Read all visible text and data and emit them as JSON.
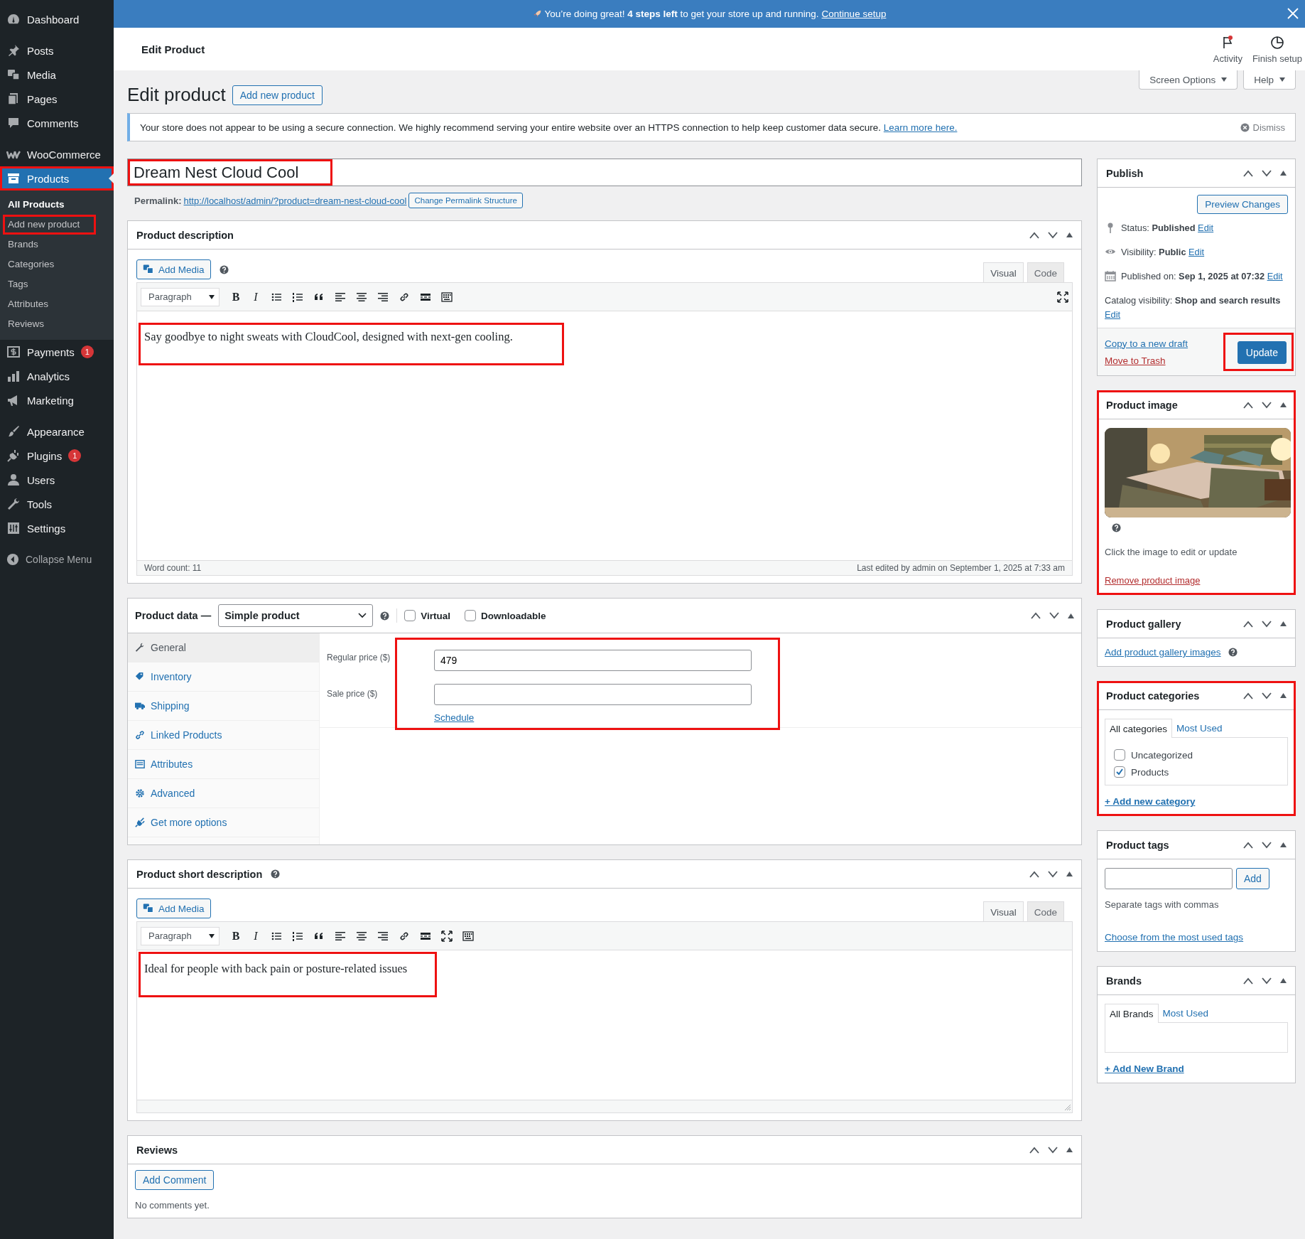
{
  "notice_bar": {
    "text": "You’re doing great! **4 steps left** to get your store up and running.",
    "link": "Continue setup"
  },
  "sidebar": {
    "groups": [
      [
        {
          "label": "Dashboard",
          "selected": false,
          "highlighted": false
        }
      ],
      [
        {
          "label": "Posts",
          "selected": false,
          "highlighted": false
        },
        {
          "label": "Media",
          "selected": false,
          "highlighted": false
        },
        {
          "label": "Pages",
          "selected": false,
          "highlighted": false
        },
        {
          "label": "Comments",
          "selected": false,
          "highlighted": false
        }
      ],
      [
        {
          "label": "WooCommerce",
          "selected": false,
          "highlighted": false
        },
        {
          "label": "Products",
          "selected": true,
          "highlighted": true,
          "children": [
            {
              "label": "All Products",
              "selected": true,
              "highlighted": false
            },
            {
              "label": "Add new product",
              "selected": false,
              "highlighted": true
            },
            {
              "label": "Brands",
              "selected": false,
              "highlighted": false
            },
            {
              "label": "Categories",
              "selected": false,
              "highlighted": false
            },
            {
              "label": "Tags",
              "selected": false,
              "highlighted": false
            },
            {
              "label": "Attributes",
              "selected": false,
              "highlighted": false
            },
            {
              "label": "Reviews",
              "selected": false,
              "highlighted": false
            }
          ]
        },
        {
          "label": "Payments",
          "badge": "1",
          "selected": false,
          "highlighted": false
        },
        {
          "label": "Analytics",
          "selected": false,
          "highlighted": false
        },
        {
          "label": "Marketing",
          "selected": false,
          "highlighted": false
        }
      ],
      [
        {
          "label": "Appearance",
          "selected": false,
          "highlighted": false
        },
        {
          "label": "Plugins",
          "badge": "1",
          "selected": false,
          "highlighted": false
        },
        {
          "label": "Users",
          "selected": false,
          "highlighted": false
        },
        {
          "label": "Tools",
          "selected": false,
          "highlighted": false
        },
        {
          "label": "Settings",
          "selected": false,
          "highlighted": false
        }
      ]
    ],
    "collapse": "Collapse Menu"
  },
  "header": {
    "title": "Edit Product",
    "actions": [
      {
        "label": "Activity",
        "unread": true
      },
      {
        "label": "Finish setup",
        "unread": false
      }
    ]
  },
  "screen_tabs": [
    "Screen Options",
    "Help"
  ],
  "page": {
    "heading": "Edit product",
    "add_button": "Add new product"
  },
  "notice": {
    "text": "Your store does not appear to be using a secure connection. We highly recommend serving your entire website over an HTTPS connection to help keep customer data secure.",
    "link": "Learn more here.",
    "dismiss": "Dismiss"
  },
  "title_field": {
    "value": "Dream Nest Cloud Cool",
    "highlighted": true
  },
  "permalink": {
    "label": "Permalink:",
    "url": "http://localhost/admin/?product=dream-nest-cloud-cool",
    "button": "Change Permalink Structure"
  },
  "description": {
    "title": "Product description",
    "add_media": "Add Media",
    "tabs": [
      {
        "label": "Visual",
        "selected": true
      },
      {
        "label": "Code",
        "selected": false
      }
    ],
    "format": "Paragraph",
    "toolbar": [
      {
        "kind": "bold",
        "text": "B"
      },
      {
        "kind": "italic",
        "text": "I"
      },
      {
        "kind": "bullets"
      },
      {
        "kind": "numbers"
      },
      {
        "kind": "quote"
      },
      {
        "kind": "align-left"
      },
      {
        "kind": "align-center"
      },
      {
        "kind": "align-right"
      },
      {
        "kind": "link"
      },
      {
        "kind": "more"
      },
      {
        "kind": "kitchen"
      }
    ],
    "toolbar_right": [
      {
        "kind": "fullscreen"
      }
    ],
    "content": "Say goodbye to night sweats with CloudCool, designed with next-gen cooling.",
    "highlighted": true,
    "word_count": "Word count: 11",
    "last_edited": "Last edited by admin on September 1, 2025 at 7:33 am"
  },
  "product_data": {
    "title": "Product data —",
    "type": "Simple product",
    "options": [
      {
        "label": "Virtual",
        "checked": false
      },
      {
        "label": "Downloadable",
        "checked": false
      }
    ],
    "tabs": [
      {
        "label": "General",
        "selected": true
      },
      {
        "label": "Inventory",
        "selected": false
      },
      {
        "label": "Shipping",
        "selected": false
      },
      {
        "label": "Linked Products",
        "selected": false
      },
      {
        "label": "Attributes",
        "selected": false
      },
      {
        "label": "Advanced",
        "selected": false
      },
      {
        "label": "Get more options",
        "selected": false
      }
    ],
    "fields": [
      {
        "label": "Regular price ($)",
        "value": "479"
      },
      {
        "label": "Sale price ($)"
      }
    ],
    "schedule": "Schedule",
    "highlighted": true
  },
  "short_description": {
    "title": "Product short description",
    "add_media": "Add Media",
    "tabs": [
      {
        "label": "Visual",
        "selected": true
      },
      {
        "label": "Code",
        "selected": false
      }
    ],
    "format": "Paragraph",
    "toolbar": [
      {
        "kind": "bold",
        "text": "B"
      },
      {
        "kind": "italic",
        "text": "I"
      },
      {
        "kind": "bullets"
      },
      {
        "kind": "numbers"
      },
      {
        "kind": "quote"
      },
      {
        "kind": "align-left"
      },
      {
        "kind": "align-center"
      },
      {
        "kind": "align-right"
      },
      {
        "kind": "link"
      },
      {
        "kind": "more"
      },
      {
        "kind": "fullscreen"
      },
      {
        "kind": "kitchen"
      }
    ],
    "content": "Ideal for people with back pain or posture-related issues",
    "highlighted": true
  },
  "reviews": {
    "title": "Reviews",
    "button": "Add Comment",
    "empty": "No comments yet."
  },
  "publish": {
    "title": "Publish",
    "preview": "Preview Changes",
    "rows": [
      {
        "label": "Status:",
        "value": "Published",
        "link": "Edit"
      },
      {
        "label": "Visibility:",
        "value": "Public",
        "link": "Edit"
      },
      {
        "label": "Published on:",
        "value": "Sep 1, 2025 at 07:32",
        "link": "Edit"
      },
      {
        "label": "Catalog visibility:",
        "value": "Shop and search results",
        "link": "Edit"
      }
    ],
    "copy": "Copy to a new draft",
    "trash": "Move to Trash",
    "update": "Update",
    "update_highlighted": true
  },
  "product_image": {
    "title": "Product image",
    "hint": "Click the image to edit or update",
    "remove": "Remove product image",
    "highlighted": true
  },
  "gallery": {
    "title": "Product gallery",
    "link": "Add product gallery images"
  },
  "categories": {
    "title": "Product categories",
    "tabs": [
      {
        "label": "All categories",
        "selected": true
      },
      {
        "label": "Most Used",
        "selected": false
      }
    ],
    "items": [
      {
        "label": "Uncategorized",
        "checked": false
      },
      {
        "label": "Products",
        "checked": true
      }
    ],
    "add": "+ Add new category",
    "highlighted": true
  },
  "tags": {
    "title": "Product tags",
    "button": "Add",
    "hint": "Separate tags with commas",
    "link": "Choose from the most used tags"
  },
  "brands": {
    "title": "Brands",
    "tabs": [
      {
        "label": "All Brands",
        "selected": true
      },
      {
        "label": "Most Used",
        "selected": false
      }
    ],
    "add": "+ Add New Brand"
  }
}
